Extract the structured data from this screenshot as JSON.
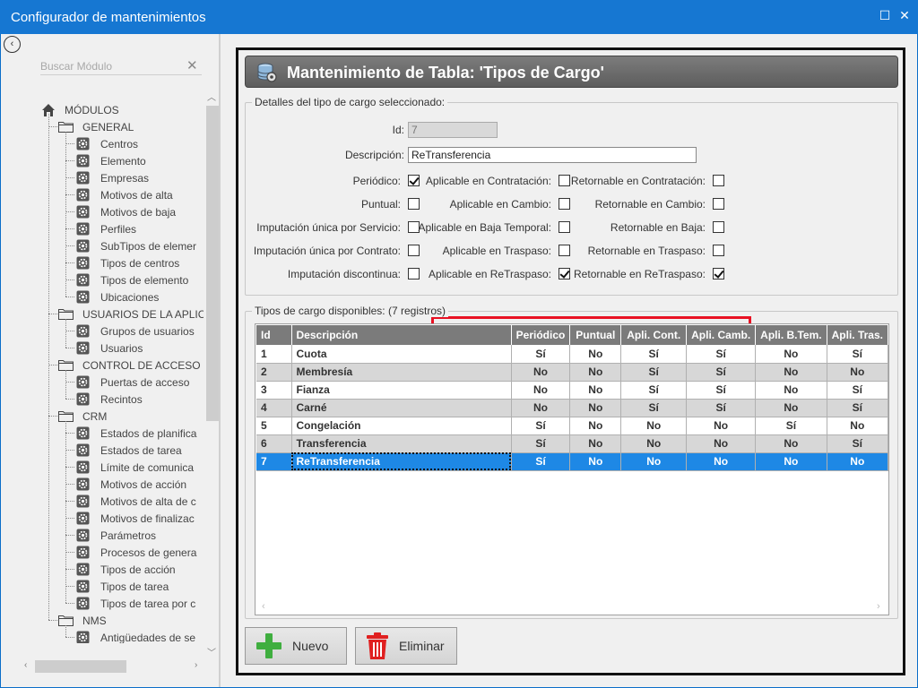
{
  "window": {
    "title": "Configurador de mantenimientos",
    "restore_glyph": "☐",
    "close_glyph": "✕"
  },
  "sidebar": {
    "back_glyph": "‹",
    "search_placeholder": "Buscar Módulo",
    "clear_glyph": "✕",
    "root_label": "MÓDULOS",
    "scroll_up": "︿",
    "scroll_down": "﹀",
    "scroll_left": "‹",
    "scroll_right": "›",
    "groups": [
      {
        "label": "GENERAL",
        "items": [
          "Centros",
          "Elemento",
          "Empresas",
          "Motivos de alta",
          "Motivos de baja",
          "Perfiles",
          "SubTipos de elemer",
          "Tipos de centros",
          "Tipos de elemento",
          "Ubicaciones"
        ]
      },
      {
        "label": "USUARIOS DE LA APLIC",
        "items": [
          "Grupos de usuarios",
          "Usuarios"
        ]
      },
      {
        "label": "CONTROL DE ACCESO",
        "items": [
          "Puertas de acceso",
          "Recintos"
        ]
      },
      {
        "label": "CRM",
        "items": [
          "Estados de planifica",
          "Estados de tarea",
          "Límite de comunica",
          "Motivos de acción",
          "Motivos de alta de c",
          "Motivos de finalizac",
          "Parámetros",
          "Procesos de genera",
          "Tipos de acción",
          "Tipos de tarea",
          "Tipos de tarea por c"
        ]
      },
      {
        "label": "NMS",
        "items": [
          "Antigüedades de se"
        ]
      }
    ]
  },
  "header": {
    "title": "Mantenimiento de Tabla: 'Tipos de Cargo'"
  },
  "details": {
    "legend": "Detalles del tipo de cargo seleccionado:",
    "id_label": "Id:",
    "id_value": "7",
    "desc_label": "Descripción:",
    "desc_value": "ReTransferencia",
    "checks": {
      "periodico": {
        "label": "Periódico:",
        "checked": true
      },
      "aplic_contratacion": {
        "label": "Aplicable en Contratación:",
        "checked": false
      },
      "retorn_contratacion": {
        "label": "Retornable en Contratación:",
        "checked": false
      },
      "puntual": {
        "label": "Puntual:",
        "checked": false
      },
      "aplic_cambio": {
        "label": "Aplicable en Cambio:",
        "checked": false
      },
      "retorn_cambio": {
        "label": "Retornable en Cambio:",
        "checked": false
      },
      "imput_servicio": {
        "label": "Imputación única por Servicio:",
        "checked": false
      },
      "aplic_baja": {
        "label": "Aplicable en Baja Temporal:",
        "checked": false
      },
      "retorn_baja": {
        "label": "Retornable en Baja:",
        "checked": false
      },
      "imput_contrato": {
        "label": "Imputación única por Contrato:",
        "checked": false
      },
      "aplic_traspaso": {
        "label": "Aplicable en Traspaso:",
        "checked": false
      },
      "retorn_traspaso": {
        "label": "Retornable en Traspaso:",
        "checked": false
      },
      "imput_discontinua": {
        "label": "Imputación discontinua:",
        "checked": false
      },
      "aplic_retraspaso": {
        "label": "Aplicable en ReTraspaso:",
        "checked": true
      },
      "retorn_retraspaso": {
        "label": "Retornable en ReTraspaso:",
        "checked": true
      }
    }
  },
  "list": {
    "legend": "Tipos de cargo disponibles:  (7 registros)",
    "columns": [
      "Id",
      "Descripción",
      "Periódico",
      "Puntual",
      "Apli. Cont.",
      "Apli. Camb.",
      "Apli. B.Tem.",
      "Apli. Tras."
    ],
    "rows": [
      [
        "1",
        "Cuota",
        "Sí",
        "No",
        "Sí",
        "Sí",
        "No",
        "Sí"
      ],
      [
        "2",
        "Membresía",
        "No",
        "No",
        "Sí",
        "Sí",
        "No",
        "No"
      ],
      [
        "3",
        "Fianza",
        "No",
        "No",
        "Sí",
        "Sí",
        "No",
        "Sí"
      ],
      [
        "4",
        "Carné",
        "No",
        "No",
        "Sí",
        "Sí",
        "No",
        "Sí"
      ],
      [
        "5",
        "Congelación",
        "Sí",
        "No",
        "No",
        "No",
        "Sí",
        "No"
      ],
      [
        "6",
        "Transferencia",
        "Sí",
        "No",
        "No",
        "No",
        "No",
        "Sí"
      ],
      [
        "7",
        "ReTransferencia",
        "Sí",
        "No",
        "No",
        "No",
        "No",
        "No"
      ]
    ],
    "selected_index": 6,
    "scroll_left": "‹",
    "scroll_right": "›"
  },
  "buttons": {
    "new_label": "Nuevo",
    "delete_label": "Eliminar"
  },
  "colors": {
    "titlebar": "#1677d2",
    "header": "#6a6a6a",
    "selection": "#1e88e5",
    "highlight": "#e81123",
    "add_green": "#3fae3f",
    "delete_red": "#e02020"
  }
}
